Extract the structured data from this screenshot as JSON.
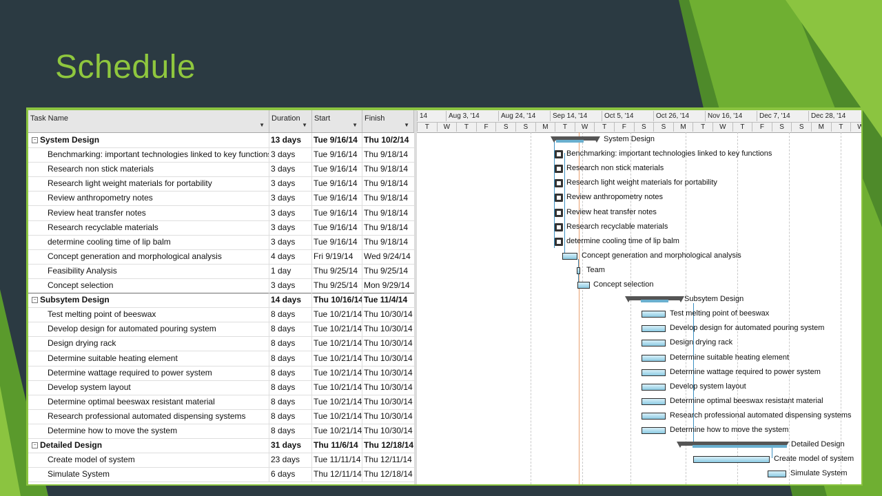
{
  "slide": {
    "title": "Schedule"
  },
  "colors": {
    "background": "#2b3a42",
    "accent": "#8fc73e",
    "frame": "#8bc440",
    "bar_fill": "#8ccbe3",
    "summary": "#555555"
  },
  "table": {
    "columns": [
      {
        "label": "Task Name",
        "has_dropdown": true
      },
      {
        "label": "Duration",
        "has_dropdown": true
      },
      {
        "label": "Start",
        "has_dropdown": true
      },
      {
        "label": "Finish",
        "has_dropdown": true
      }
    ],
    "rows": [
      {
        "name": "System Design",
        "duration": "13 days",
        "start": "Tue 9/16/14",
        "finish": "Thu 10/2/14",
        "summary": true
      },
      {
        "name": "Benchmarking: important technologies linked to key functions",
        "duration": "3 days",
        "start": "Tue 9/16/14",
        "finish": "Thu 9/18/14"
      },
      {
        "name": "Research non stick materials",
        "duration": "3 days",
        "start": "Tue 9/16/14",
        "finish": "Thu 9/18/14"
      },
      {
        "name": "Research light weight materials for portability",
        "duration": "3 days",
        "start": "Tue 9/16/14",
        "finish": "Thu 9/18/14"
      },
      {
        "name": "Review anthropometry notes",
        "duration": "3 days",
        "start": "Tue 9/16/14",
        "finish": "Thu 9/18/14"
      },
      {
        "name": "Review heat transfer notes",
        "duration": "3 days",
        "start": "Tue 9/16/14",
        "finish": "Thu 9/18/14"
      },
      {
        "name": "Research recyclable materials",
        "duration": "3 days",
        "start": "Tue 9/16/14",
        "finish": "Thu 9/18/14"
      },
      {
        "name": "determine cooling time of lip balm",
        "duration": "3 days",
        "start": "Tue 9/16/14",
        "finish": "Thu 9/18/14"
      },
      {
        "name": "Concept generation and morphological analysis",
        "duration": "4 days",
        "start": "Fri 9/19/14",
        "finish": "Wed 9/24/14"
      },
      {
        "name": "Feasibility Analysis",
        "duration": "1 day",
        "start": "Thu 9/25/14",
        "finish": "Thu 9/25/14"
      },
      {
        "name": "Concept selection",
        "duration": "3 days",
        "start": "Thu 9/25/14",
        "finish": "Mon 9/29/14"
      },
      {
        "name": "Subsytem Design",
        "duration": "14 days",
        "start": "Thu 10/16/14",
        "finish": "Tue 11/4/14",
        "summary": true
      },
      {
        "name": "Test melting point of beeswax",
        "duration": "8 days",
        "start": "Tue 10/21/14",
        "finish": "Thu 10/30/14"
      },
      {
        "name": "Develop design for automated pouring system",
        "duration": "8 days",
        "start": "Tue 10/21/14",
        "finish": "Thu 10/30/14"
      },
      {
        "name": "Design drying rack",
        "duration": "8 days",
        "start": "Tue 10/21/14",
        "finish": "Thu 10/30/14"
      },
      {
        "name": "Determine suitable heating element",
        "duration": "8 days",
        "start": "Tue 10/21/14",
        "finish": "Thu 10/30/14"
      },
      {
        "name": "Determine wattage required to power system",
        "duration": "8 days",
        "start": "Tue 10/21/14",
        "finish": "Thu 10/30/14"
      },
      {
        "name": "Develop system layout",
        "duration": "8 days",
        "start": "Tue 10/21/14",
        "finish": "Thu 10/30/14"
      },
      {
        "name": "Determine optimal beeswax resistant material",
        "duration": "8 days",
        "start": "Tue 10/21/14",
        "finish": "Thu 10/30/14"
      },
      {
        "name": "Research professional automated dispensing systems",
        "duration": "8 days",
        "start": "Tue 10/21/14",
        "finish": "Thu 10/30/14"
      },
      {
        "name": "Determine how to move the system",
        "duration": "8 days",
        "start": "Tue 10/21/14",
        "finish": "Thu 10/30/14"
      },
      {
        "name": "Detailed Design",
        "duration": "31 days",
        "start": "Thu 11/6/14",
        "finish": "Thu 12/18/14",
        "summary": true
      },
      {
        "name": "Create model of system",
        "duration": "23 days",
        "start": "Tue 11/11/14",
        "finish": "Thu 12/11/14"
      },
      {
        "name": "Simulate System",
        "duration": "6 days",
        "start": "Thu 12/11/14",
        "finish": "Thu 12/18/14"
      }
    ]
  },
  "timeline": {
    "weeks": [
      "14",
      "Aug 3, '14",
      "Aug 24, '14",
      "Sep 14, '14",
      "Oct 5, '14",
      "Oct 26, '14",
      "Nov 16, '14",
      "Dec 7, '14",
      "Dec 28, '14"
    ],
    "days": [
      "T",
      "W",
      "T",
      "F",
      "S",
      "S",
      "M",
      "T",
      "W",
      "T",
      "F",
      "S",
      "S",
      "M",
      "T",
      "W",
      "T",
      "F",
      "S",
      "S",
      "M",
      "T",
      "W"
    ],
    "bar_labels": [
      "System Design",
      "Benchmarking: important technologies linked to key functions",
      "Research non stick materials",
      "Research light weight materials for portability",
      "Review anthropometry notes",
      "Review heat transfer notes",
      "Research recyclable materials",
      "determine cooling time of lip balm",
      "Concept generation and morphological analysis",
      "Team",
      "Concept selection",
      "Subsytem Design",
      "Test melting point of beeswax",
      "Develop design for automated pouring system",
      "Design drying rack",
      "Determine suitable heating element",
      "Determine wattage required to power system",
      "Develop system layout",
      "Determine optimal beeswax resistant material",
      "Research professional automated dispensing systems",
      "Determine how to move the system",
      "Detailed Design",
      "Create model of system",
      "Simulate System"
    ]
  }
}
